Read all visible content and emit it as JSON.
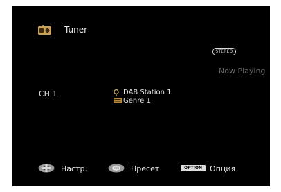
{
  "source": {
    "label": "Tuner",
    "icon": "radio-icon"
  },
  "stereo_badge": "STEREO",
  "now_playing": "Now Playing",
  "channel": "CH 1",
  "station": {
    "name": "DAB Station 1",
    "icon": "pin-icon"
  },
  "genre": {
    "name": "Genre 1",
    "icon": "genre-icon"
  },
  "controls": {
    "settings": {
      "label": "Настр.",
      "icon": "cross-keypad-icon"
    },
    "preset": {
      "label": "Пресет",
      "icon": "dpad-icon"
    },
    "option": {
      "key_label": "OPTION",
      "label": "Опция"
    }
  }
}
